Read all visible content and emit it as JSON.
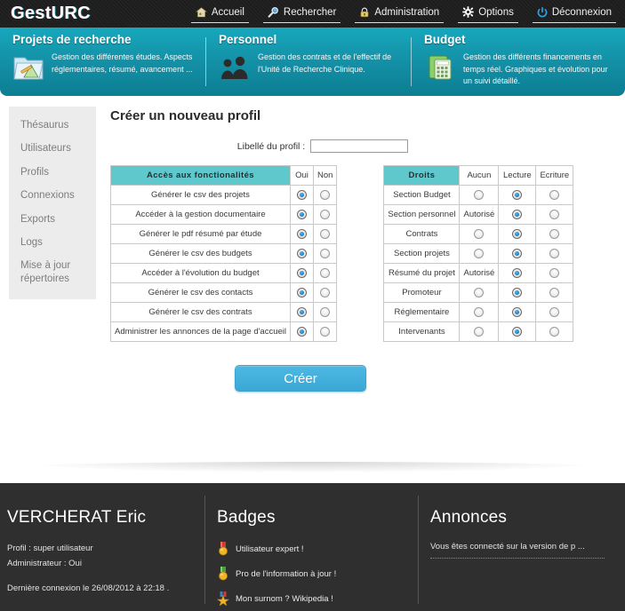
{
  "app": {
    "logo": "GestURC"
  },
  "topnav": [
    {
      "label": "Accueil",
      "icon": "home-icon"
    },
    {
      "label": "Rechercher",
      "icon": "search-icon"
    },
    {
      "label": "Administration",
      "icon": "lock-icon"
    },
    {
      "label": "Options",
      "icon": "gear-icon"
    },
    {
      "label": "Déconnexion",
      "icon": "power-icon"
    }
  ],
  "banner": {
    "accent": "#13a0b6",
    "columns": [
      {
        "title": "Projets de recherche",
        "description": "Gestion des différentes études. Aspects réglementaires, résumé, avancement ...",
        "icon": "folder-project-icon"
      },
      {
        "title": "Personnel",
        "description": "Gestion des contrats et de l'effectif de l'Unité de Recherche Clinique.",
        "icon": "people-icon"
      },
      {
        "title": "Budget",
        "description": "Gestion des différents financements en temps réel. Graphiques et évolution pour un suivi détaillé.",
        "icon": "calculator-icon"
      }
    ]
  },
  "sidebar": {
    "items": [
      {
        "label": "Thésaurus"
      },
      {
        "label": "Utilisateurs"
      },
      {
        "label": "Profils"
      },
      {
        "label": "Connexions"
      },
      {
        "label": "Exports"
      },
      {
        "label": "Logs"
      },
      {
        "label": "Mise à jour répertoires"
      }
    ]
  },
  "main": {
    "title": "Créer un nouveau profil",
    "profile_label": "Libellé du profil :",
    "profile_value": "",
    "profile_placeholder": "",
    "submit_label": "Créer",
    "colors": {
      "header_teal": "#5ec8cd",
      "yes_green": "#96e79b",
      "read_yellow": "#f2c807",
      "button_blue": "#3aa7d6"
    },
    "features_table": {
      "headers": [
        "Accès aux fonctionalités",
        "Oui",
        "Non"
      ],
      "rows": [
        {
          "name": "Générer le csv des projets",
          "selected": "Oui"
        },
        {
          "name": "Accéder à la gestion documentaire",
          "selected": "Oui"
        },
        {
          "name": "Générer le pdf résumé par étude",
          "selected": "Oui"
        },
        {
          "name": "Générer le csv des budgets",
          "selected": "Oui"
        },
        {
          "name": "Accéder à l'évolution du budget",
          "selected": "Oui"
        },
        {
          "name": "Générer le csv des contacts",
          "selected": "Oui"
        },
        {
          "name": "Générer le csv des contrats",
          "selected": "Oui"
        },
        {
          "name": "Administrer les annonces de la page d'accueil",
          "selected": "Oui"
        }
      ]
    },
    "rights_table": {
      "headers": [
        "Droits",
        "Aucun",
        "Lecture",
        "Ecriture"
      ],
      "rows": [
        {
          "name": "Section Budget",
          "aucun": "radio",
          "selected": "Lecture"
        },
        {
          "name": "Section personnel",
          "aucun": "Autorisé",
          "selected": "Lecture"
        },
        {
          "name": "Contrats",
          "aucun": "radio",
          "selected": "Lecture"
        },
        {
          "name": "Section projets",
          "aucun": "radio",
          "selected": "Lecture"
        },
        {
          "name": "Résumé du projet",
          "aucun": "Autorisé",
          "selected": "Lecture"
        },
        {
          "name": "Promoteur",
          "aucun": "radio",
          "selected": "Lecture"
        },
        {
          "name": "Réglementaire",
          "aucun": "radio",
          "selected": "Lecture"
        },
        {
          "name": "Intervenants",
          "aucun": "radio",
          "selected": "Lecture"
        }
      ]
    }
  },
  "footer": {
    "user": {
      "name": "VERCHERAT Eric",
      "profile": "Profil : super utilisateur",
      "admin": "Administrateur : Oui",
      "last_connection": "Dernière connexion le 26/08/2012 à 22:18 ."
    },
    "badges": {
      "title": "Badges",
      "items": [
        {
          "label": "Utilisateur expert !",
          "icon": "medal-red-icon"
        },
        {
          "label": "Pro de l'information à jour !",
          "icon": "medal-green-icon"
        },
        {
          "label": "Mon surnom ? Wikipedia !",
          "icon": "star-badge-icon"
        }
      ]
    },
    "annonces": {
      "title": "Annonces",
      "items": [
        {
          "text": "Vous êtes connecté sur la version de p ..."
        }
      ]
    }
  }
}
